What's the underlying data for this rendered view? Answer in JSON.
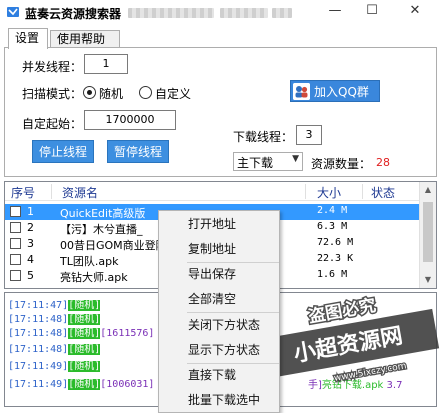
{
  "window": {
    "title": "蓝奏云资源搜索器",
    "controls": {
      "minimize": "—",
      "maximize": "☐",
      "close": "✕"
    }
  },
  "tabs": [
    {
      "label": "设置",
      "active": true
    },
    {
      "label": "使用帮助",
      "active": false
    }
  ],
  "settings": {
    "concurrency_label": "并发线程：",
    "concurrency_value": "1",
    "scan_mode_label": "扫描模式：",
    "mode_random_label": "随机",
    "mode_custom_label": "自定义",
    "mode_selected": "random",
    "start_label": "自定起始：",
    "start_value": "1700000",
    "stop_button": "停止线程",
    "pause_button": "暂停线程",
    "qq_button": "加入QQ群",
    "download_threads_label": "下载线程：",
    "download_threads_value": "3",
    "download_mode_selected": "主下载",
    "resource_count_label": "资源数量：",
    "resource_count_value": "28"
  },
  "list": {
    "columns": [
      "序号",
      "资源名",
      "大小",
      "状态"
    ],
    "rows": [
      {
        "index": "1",
        "name": "QuickEdit高级版",
        "size": "2.4 M",
        "selected": true
      },
      {
        "index": "2",
        "name": "【污】木兮直播_",
        "size": "6.3 M",
        "selected": false
      },
      {
        "index": "3",
        "name": "00昔日GOM商业登陆",
        "size": "72.6 M",
        "selected": false
      },
      {
        "index": "4",
        "name": "TL团队.apk",
        "size": "22.3 K",
        "selected": false
      },
      {
        "index": "5",
        "name": "亮钻大师.apk",
        "size": "1.6 M",
        "selected": false
      }
    ]
  },
  "log": {
    "lines": [
      {
        "time": "[17:11:47]",
        "mode": "[随机]",
        "rest": ""
      },
      {
        "time": "[17:11:48]",
        "mode": "[随机]",
        "rest": ""
      },
      {
        "time": "[17:11:48]",
        "mode": "[随机]",
        "rest": "[1611576]"
      },
      {
        "time": "[17:11:48]",
        "mode": "[随机]",
        "rest": ""
      },
      {
        "time": "[17:11:49]",
        "mode": "[随机]",
        "rest": ""
      },
      {
        "time": "[17:11:49]",
        "mode": "[随机]",
        "rest": "[1006031]"
      }
    ],
    "tail_text": "手]",
    "tail_text2": "亮钻下载.apk",
    "tail_size": "3.7"
  },
  "context_menu": {
    "items": [
      "打开地址",
      "复制地址",
      "导出保存",
      "全部清空",
      "关闭下方状态",
      "显示下方状态",
      "直接下载",
      "批量下载选中"
    ]
  },
  "watermark": {
    "line1": "盗图必究",
    "line2": "小超资源网",
    "line3": "www.5ixczy.com"
  },
  "colors": {
    "accent_blue": "#3d8fe0",
    "selection": "#3399ff",
    "count_red": "#e02020",
    "log_time": "#2e63c9",
    "log_green": "#2bbb2b"
  }
}
